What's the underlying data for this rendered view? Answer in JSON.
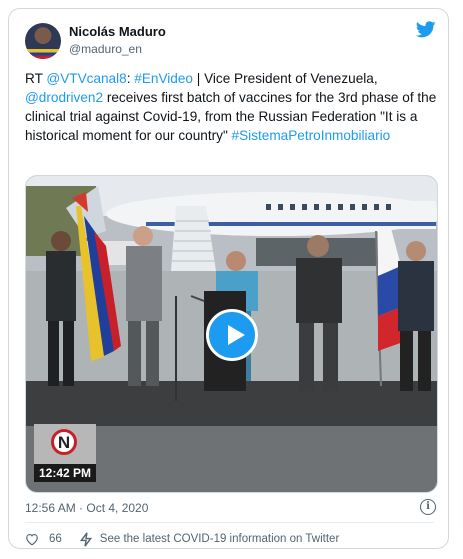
{
  "author": {
    "name": "Nicolás Maduro",
    "handle": "@maduro_en"
  },
  "icons": {
    "avatar": "profile-avatar",
    "brand": "twitter-bird-icon",
    "play": "play-icon",
    "info": "info-icon",
    "like": "heart-icon",
    "covid": "lightning-icon"
  },
  "colors": {
    "link": "#1d9bf0",
    "text": "#0f1419",
    "muted": "#536471"
  },
  "tweet": {
    "prefix": "RT ",
    "mention1": "@VTVcanal8",
    "sep1": ": ",
    "hashtag1": "#EnVideo",
    "text1": " | Vice President of Venezuela, ",
    "mention2": "@drodriven2",
    "text2": " receives first batch of vaccines for the 3rd phase of the clinical trial against Covid-19, from the Russian Federation \"It is a historical moment for our country\" ",
    "hashtag2": "#SistemaPetroInmobiliario"
  },
  "video": {
    "channel_logo": "N",
    "clock": "12:42 PM"
  },
  "timestamp": "12:56 AM · Oct 4, 2020",
  "likes": "66",
  "covid_link": "See the latest COVID-19 information on Twitter"
}
